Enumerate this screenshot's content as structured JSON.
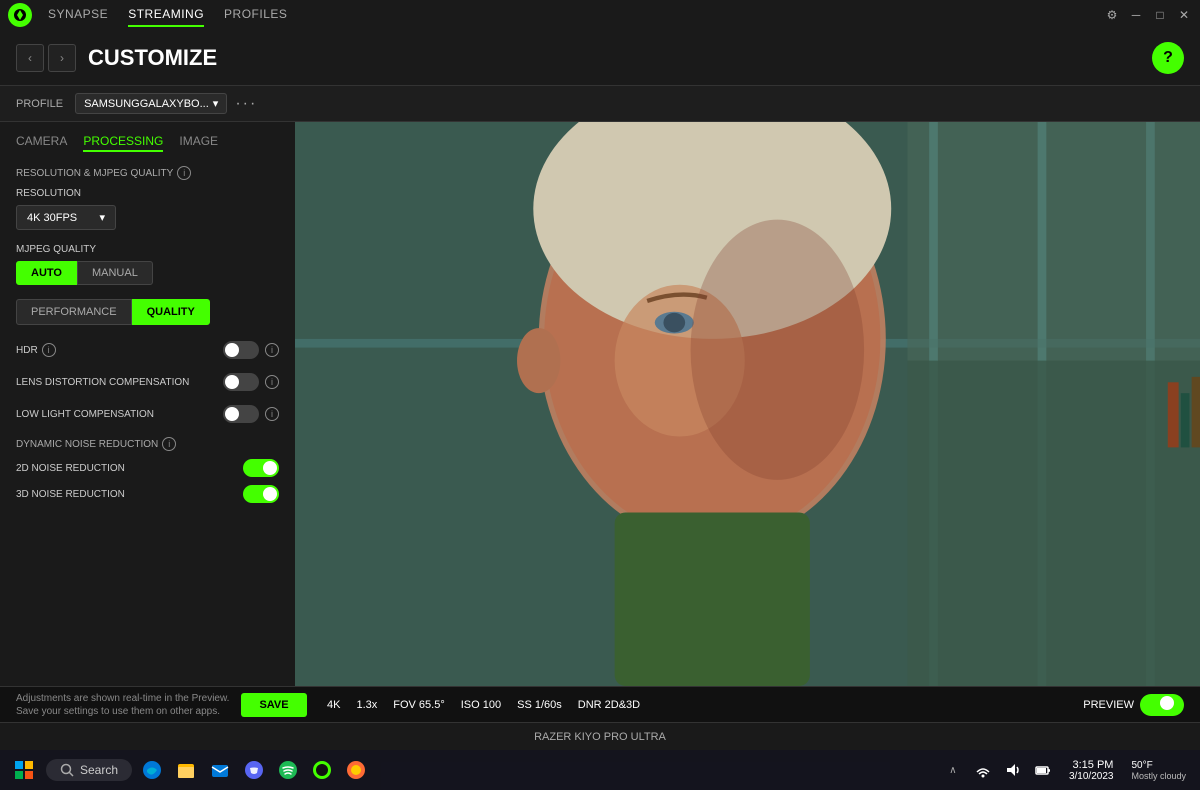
{
  "titlebar": {
    "logo_alt": "Razer logo",
    "nav": [
      "SYNAPSE",
      "STREAMING",
      "PROFILES"
    ],
    "active_nav": "STREAMING",
    "controls": [
      "settings-icon",
      "minimize-icon",
      "maximize-icon",
      "close-icon"
    ]
  },
  "header": {
    "title": "CUSTOMIZE",
    "help_label": "?"
  },
  "profile": {
    "label": "PROFILE",
    "name": "SAMSUNGGALAXYBO...",
    "more_icon": "···"
  },
  "tabs": {
    "camera": "CAMERA",
    "processing": "PROCESSING",
    "image": "IMAGE",
    "active": "PROCESSING"
  },
  "settings": {
    "resolution_mjpeg_label": "RESOLUTION & MJPEG QUALITY",
    "resolution_label": "RESOLUTION",
    "resolution_value": "4K 30FPS",
    "mjpeg_quality_label": "MJPEG QUALITY",
    "mjpeg_auto": "AUTO",
    "mjpeg_manual": "MANUAL",
    "mjpeg_active": "AUTO",
    "performance_label": "PERFORMANCE",
    "quality_label": "QUALITY",
    "perf_active": "QUALITY",
    "hdr_label": "HDR",
    "hdr_enabled": false,
    "lens_distortion_label": "LENS DISTORTION COMPENSATION",
    "lens_distortion_enabled": false,
    "low_light_label": "LOW LIGHT COMPENSATION",
    "low_light_enabled": false,
    "dnr_label": "DYNAMIC NOISE REDUCTION",
    "dnr_2d_label": "2D NOISE REDUCTION",
    "dnr_2d_enabled": true,
    "dnr_3d_label": "3D NOISE REDUCTION",
    "dnr_3d_enabled": true
  },
  "bottom": {
    "info_text_1": "Adjustments are shown real-time in the Preview.",
    "info_text_2": "Save your settings to use them on other apps.",
    "save_label": "SAVE",
    "stats": {
      "resolution": "4K",
      "zoom": "1.3x",
      "fov": "FOV 65.5°",
      "iso": "ISO 100",
      "ss": "SS 1/60s",
      "dnr": "DNR 2D&3D"
    },
    "preview_label": "PREVIEW"
  },
  "camera_name": "RAZER KIYO PRO ULTRA",
  "taskbar": {
    "start_icon": "⊞",
    "search_placeholder": "Search",
    "weather_temp": "50°F",
    "weather_desc": "Mostly cloudy",
    "time": "3:15 PM",
    "date": "3/10/2023",
    "taskbar_icons": [
      "taskbar-icon-1",
      "taskbar-icon-2",
      "taskbar-icon-3",
      "taskbar-icon-4",
      "taskbar-icon-5",
      "taskbar-icon-6",
      "taskbar-icon-7",
      "taskbar-icon-8",
      "taskbar-icon-9"
    ]
  }
}
